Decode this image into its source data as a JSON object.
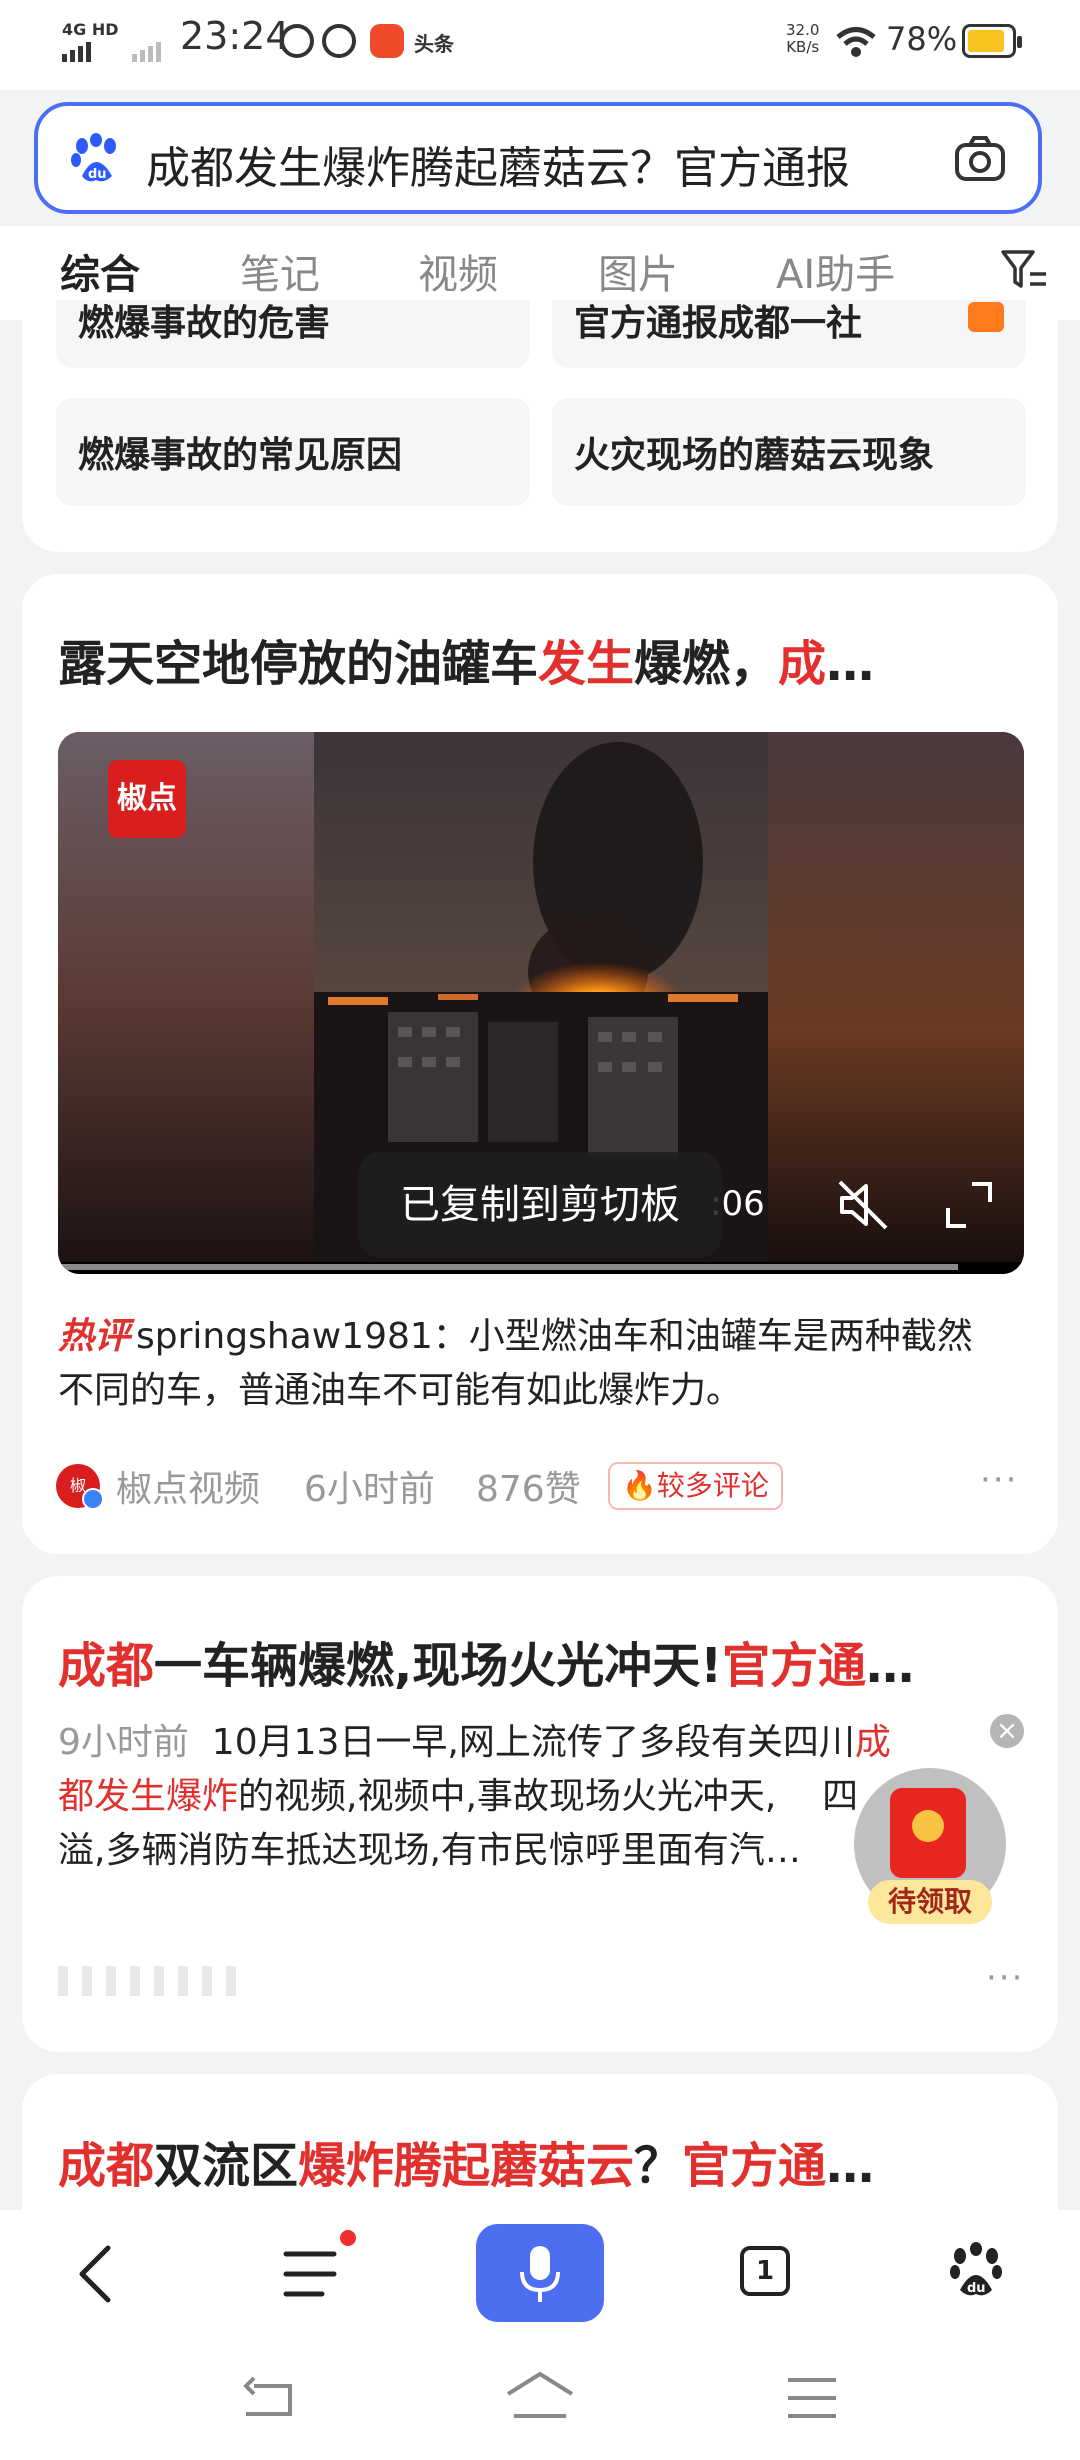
{
  "status_bar": {
    "network_type": "4G HD",
    "time": "23:24",
    "app_icon_label": "头条",
    "speed_value": "32.0",
    "speed_unit": "KB/s",
    "battery_percent": "78%"
  },
  "search": {
    "query": "成都发生爆炸腾起蘑菇云？官方通报"
  },
  "tabs": [
    {
      "label": "综合",
      "active": true
    },
    {
      "label": "笔记"
    },
    {
      "label": "视频"
    },
    {
      "label": "图片"
    },
    {
      "label": "AI助手"
    }
  ],
  "related": {
    "top_left_partial": "燃爆事故的危害",
    "top_right_partial": "官方通报成都一社",
    "items": [
      "燃爆事故的常见原因",
      "火灾现场的蘑菇云现象"
    ]
  },
  "result1": {
    "title_a": "露天空地停放的油罐车",
    "title_b": "发生",
    "title_c": "爆燃，",
    "title_d": "成",
    "title_ellipsis": "…",
    "video_badge": "椒点",
    "video_time": ":06",
    "toast": "已复制到剪切板",
    "hot_label": "热评",
    "hot_comment": "springshaw1981：小型燃油车和油罐车是两种截然不同的车，普通油车不可能有如此爆炸力。",
    "source": "椒点视频",
    "time_ago": "6小时前",
    "likes": "876赞",
    "tag": "较多评论",
    "source_avatar_text": "椒"
  },
  "result2": {
    "title_a": "成都",
    "title_b": "一车辆爆燃,现场火光冲天!",
    "title_c": "官方通",
    "title_ellipsis": "…",
    "time_ago": "9小时前",
    "line1_a": "10月13日一早,网上流传了多段有关四川",
    "line1_b": "成",
    "line2_a": "都发生爆炸",
    "line2_b": "的视频,视频中,事故现场火光冲天,",
    "line2_c": "四",
    "line3": "溢,多辆消防车抵达现场,有市民惊呼里面有汽",
    "line3_ellipsis": "…"
  },
  "red_packet": {
    "label": "待领取"
  },
  "result3": {
    "title_a": "成都",
    "title_b": "双流区",
    "title_c": "爆炸腾起蘑菇云",
    "title_d": "？",
    "title_e": "官方通",
    "title_ellipsis": "…"
  },
  "bottom_nav": {
    "tab_count": "1"
  },
  "colors": {
    "accent": "#4e6ef2",
    "highlight": "#e2302e",
    "background": "#f2f3f5"
  }
}
